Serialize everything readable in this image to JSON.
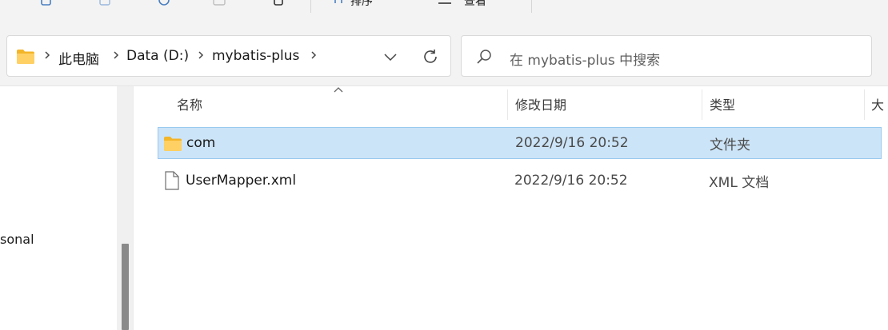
{
  "toolbar": {
    "partial_label_1": "排序",
    "partial_label_2": "查看"
  },
  "address_bar": {
    "breadcrumbs": [
      "此电脑",
      "Data (D:)",
      "mybatis-plus"
    ]
  },
  "search": {
    "placeholder": "在 mybatis-plus 中搜索"
  },
  "nav_pane": {
    "partial_item": "sonal"
  },
  "columns": {
    "name": "名称",
    "date_modified": "修改日期",
    "type": "类型",
    "size": "大"
  },
  "files": [
    {
      "name": "com",
      "date_modified": "2022/9/16 20:52",
      "type": "文件夹",
      "icon": "folder-icon",
      "selected": true
    },
    {
      "name": "UserMapper.xml",
      "date_modified": "2022/9/16 20:52",
      "type": "XML 文档",
      "icon": "file-icon",
      "selected": false
    }
  ],
  "colors": {
    "selection_bg": "#cce4f7",
    "selection_border": "#99c9ef",
    "folder_yellow": "#ffc83d"
  }
}
